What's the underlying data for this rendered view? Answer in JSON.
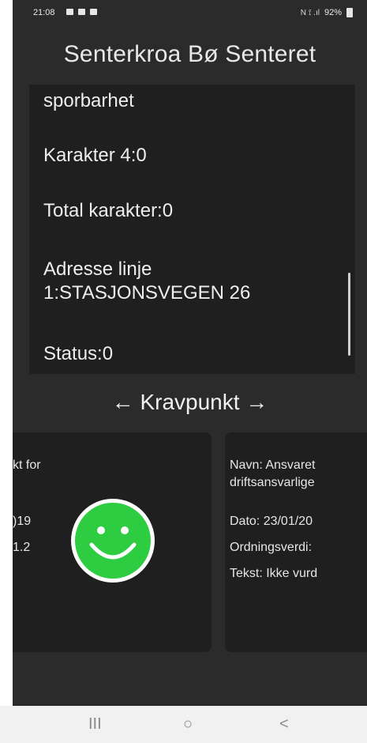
{
  "status_bar": {
    "time": "21:08",
    "right_indicators": "N ⟟ .ıl",
    "battery": "92%"
  },
  "header": {
    "title": "Senterkroa Bø Senteret"
  },
  "details": {
    "items": [
      "sporbarhet",
      "Karakter 4:0",
      "Total karakter:0",
      "Adresse linje 1:STASJONSVEGEN 26",
      "Status:0"
    ]
  },
  "section": {
    "title": "← Kravpunkt →"
  },
  "cards": {
    "left": {
      "lines": [
        "kt for",
        ")19",
        "1.2"
      ]
    },
    "right": {
      "lines": [
        "Navn:  Ansvaret",
        "driftsansvarlige",
        "Dato:  23/01/20",
        "Ordningsverdi:",
        "Tekst:  Ikke vurd"
      ]
    }
  },
  "colors": {
    "background": "#2b2b2b",
    "card": "#1f1f1f",
    "smiley": "#2ecc40"
  },
  "icons": {
    "smiley": "smiley-face-icon",
    "nav": [
      "recent-apps-icon",
      "home-icon",
      "back-icon"
    ]
  },
  "navbar": {
    "recent": "III",
    "home": "○",
    "back": "<"
  }
}
